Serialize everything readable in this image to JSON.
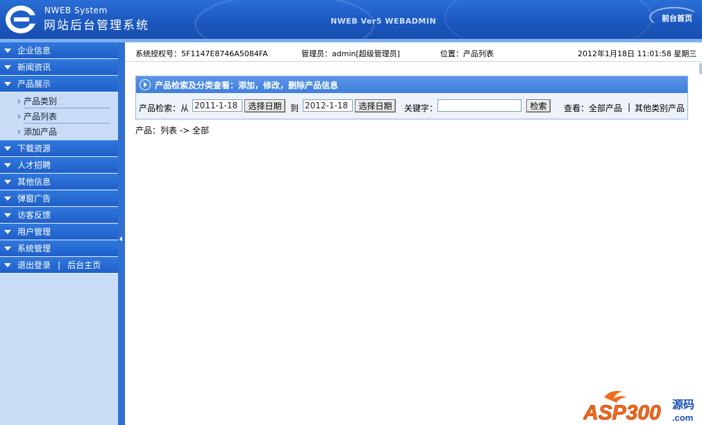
{
  "header": {
    "brand_small": "NWEB System",
    "brand_title": "网站后台管理系统",
    "center_title": "NWEB Ver5 WEBADMIN",
    "home_link": "前台首页"
  },
  "sidebar": {
    "items": [
      {
        "label": "企业信息"
      },
      {
        "label": "新闻资讯"
      },
      {
        "label": "产品展示",
        "children": [
          "产品类别",
          "产品列表",
          "添加产品"
        ]
      },
      {
        "label": "下载资源"
      },
      {
        "label": "人才招聘"
      },
      {
        "label": "其他信息"
      },
      {
        "label": "弹窗广告"
      },
      {
        "label": "访客反馈"
      },
      {
        "label": "用户管理"
      },
      {
        "label": "系统管理"
      }
    ],
    "logout": "退出登录",
    "separator": "|",
    "backend_home": "后台主页"
  },
  "topbar": {
    "license": "系统授权号：5F1147E8746A5084FA",
    "admin": "管理员：admin[超级管理员]",
    "location": "位置：产品列表",
    "datetime": "2012年1月18日 11:01:58 星期三"
  },
  "search_panel": {
    "title": "产品检索及分类查看：添加，修改，删除产品信息",
    "search_label": "产品检索：从",
    "date_from": "2011-1-18",
    "pick_date_label": "选择日期",
    "to_label": "到",
    "date_to": "2012-1-18",
    "keyword_label": "关键字：",
    "keyword_value": "",
    "search_button": "检索",
    "view_all": "查看：全部产品",
    "view_sep": "|",
    "view_other": "其他类别产品"
  },
  "breadcrumb": "产品：列表 -> 全部",
  "watermark": {
    "text": "ASP300",
    "suffix": "源码",
    "domain": ".com"
  }
}
